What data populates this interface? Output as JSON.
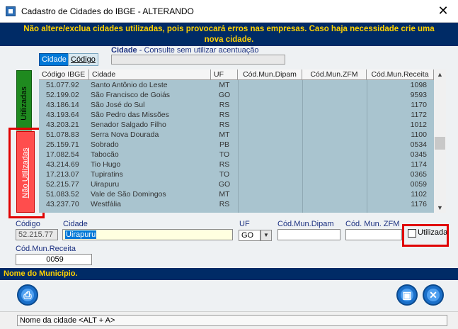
{
  "window": {
    "title": "Cadastro de Cidades do IBGE   -   ALTERANDO",
    "close_glyph": "✕"
  },
  "warning": {
    "line1": "Não altere/exclua cidades utilizadas, pois provocará erros nas empresas. Caso haja necessidade crie uma",
    "line2": "nova cidade."
  },
  "tabs": {
    "cidade": "Cidade",
    "codigo": "Código"
  },
  "search": {
    "label_bold": "Cidade",
    "label_desc": " - Consulte sem utilizar acentuação",
    "value": ""
  },
  "side_tabs": {
    "used": "Utilizadas",
    "not_used": "Não Utilizadas"
  },
  "grid": {
    "columns": [
      "Código IBGE",
      "Cidade",
      "UF",
      "Cód.Mun.Dipam",
      "Cód.Mun.ZFM",
      "Cód.Mun.Receita"
    ],
    "rows": [
      [
        "51.077.92",
        "Santo Antônio do Leste",
        "MT",
        "",
        "",
        "1098"
      ],
      [
        "52.199.02",
        "São Francisco de Goiás",
        "GO",
        "",
        "",
        "9593"
      ],
      [
        "43.186.14",
        "São José do Sul",
        "RS",
        "",
        "",
        "1170"
      ],
      [
        "43.193.64",
        "São Pedro das Missões",
        "RS",
        "",
        "",
        "1172"
      ],
      [
        "43.203.21",
        "Senador Salgado Filho",
        "RS",
        "",
        "",
        "1012"
      ],
      [
        "51.078.83",
        "Serra Nova Dourada",
        "MT",
        "",
        "",
        "1100"
      ],
      [
        "25.159.71",
        "Sobrado",
        "PB",
        "",
        "",
        "0534"
      ],
      [
        "17.082.54",
        "Tabocão",
        "TO",
        "",
        "",
        "0345"
      ],
      [
        "43.214.69",
        "Tio Hugo",
        "RS",
        "",
        "",
        "1174"
      ],
      [
        "17.213.07",
        "Tupiratins",
        "TO",
        "",
        "",
        "0365"
      ],
      [
        "52.215.77",
        "Uirapuru",
        "GO",
        "",
        "",
        "0059"
      ],
      [
        "51.083.52",
        "Vale de São Domingos",
        "MT",
        "",
        "",
        "1102"
      ],
      [
        "43.237.70",
        "Westfália",
        "RS",
        "",
        "",
        "1176"
      ]
    ]
  },
  "form": {
    "codigo_label": "Código",
    "codigo_value": "52.215.77",
    "cidade_label": "Cidade",
    "cidade_value": "Uirapuru",
    "uf_label": "UF",
    "uf_value": "GO",
    "dipam_label": "Cód.Mun.Dipam",
    "dipam_value": "",
    "zfm_label": "Cód. Mun. ZFM",
    "zfm_value": "",
    "utilizada_label": "Utilizada",
    "utilizada_checked": false,
    "receita_label": "Cód.Mun.Receita",
    "receita_value": "0059"
  },
  "status_text": "Nome do Município.",
  "footer_hint": "Nome da cidade <ALT + A>",
  "colors": {
    "banner_bg": "#002b66",
    "banner_text": "#ffd200",
    "grid_bg": "#a9c4cf",
    "highlight_red": "#e00000"
  }
}
